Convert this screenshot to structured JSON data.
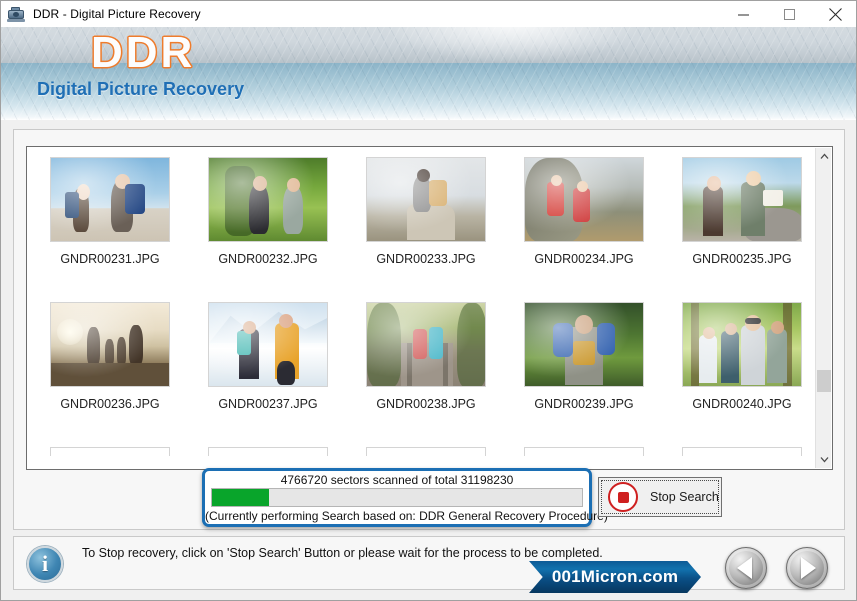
{
  "window": {
    "title": "DDR - Digital Picture Recovery",
    "icon": "scanner-camera-icon",
    "minimize_label": "Minimize",
    "maximize_label": "Maximize",
    "close_label": "Close"
  },
  "banner": {
    "logo": "DDR",
    "subtitle": "Digital Picture Recovery",
    "logo_outline_color": "#f07a28",
    "subtitle_color": "#1f6fb5"
  },
  "thumbnails": [
    {
      "label": "GNDR00231.JPG",
      "scene": "sky-blue"
    },
    {
      "label": "GNDR00232.JPG",
      "scene": "forest"
    },
    {
      "label": "GNDR00233.JPG",
      "scene": "mount-haze"
    },
    {
      "label": "GNDR00234.JPG",
      "scene": "rock-ridge"
    },
    {
      "label": "GNDR00235.JPG",
      "scene": "road-sun"
    },
    {
      "label": "GNDR00236.JPG",
      "scene": "sunrise"
    },
    {
      "label": "GNDR00237.JPG",
      "scene": "snow-mt"
    },
    {
      "label": "GNDR00238.JPG",
      "scene": "rail"
    },
    {
      "label": "GNDR00239.JPG",
      "scene": "jungle"
    },
    {
      "label": "GNDR00240.JPG",
      "scene": "woods"
    }
  ],
  "scrollbar": {
    "up_arrow": "chevron-up-icon",
    "down_arrow": "chevron-down-icon"
  },
  "progress": {
    "caption": "4766720 sectors scanned of total 31198230",
    "scanned_sectors": 4766720,
    "total_sectors": 31198230,
    "percent": 15.3,
    "note": "(Currently performing Search based on:  DDR General Recovery Procedure)",
    "fill_color": "#09a52b",
    "border_color": "#1c6fb4"
  },
  "stop_button": {
    "label": "Stop Search",
    "icon": "stop-circle-icon",
    "icon_color": "#cf2020"
  },
  "status": {
    "icon": "info-icon",
    "glyph": "i",
    "message": "To Stop recovery, click on 'Stop Search' Button or please wait for the process to be completed."
  },
  "brand": {
    "text": "001Micron.com",
    "color": "#0d5b96"
  },
  "nav": {
    "prev_label": "Previous",
    "prev_icon": "triangle-left-icon",
    "next_label": "Next",
    "next_icon": "triangle-right-icon"
  }
}
